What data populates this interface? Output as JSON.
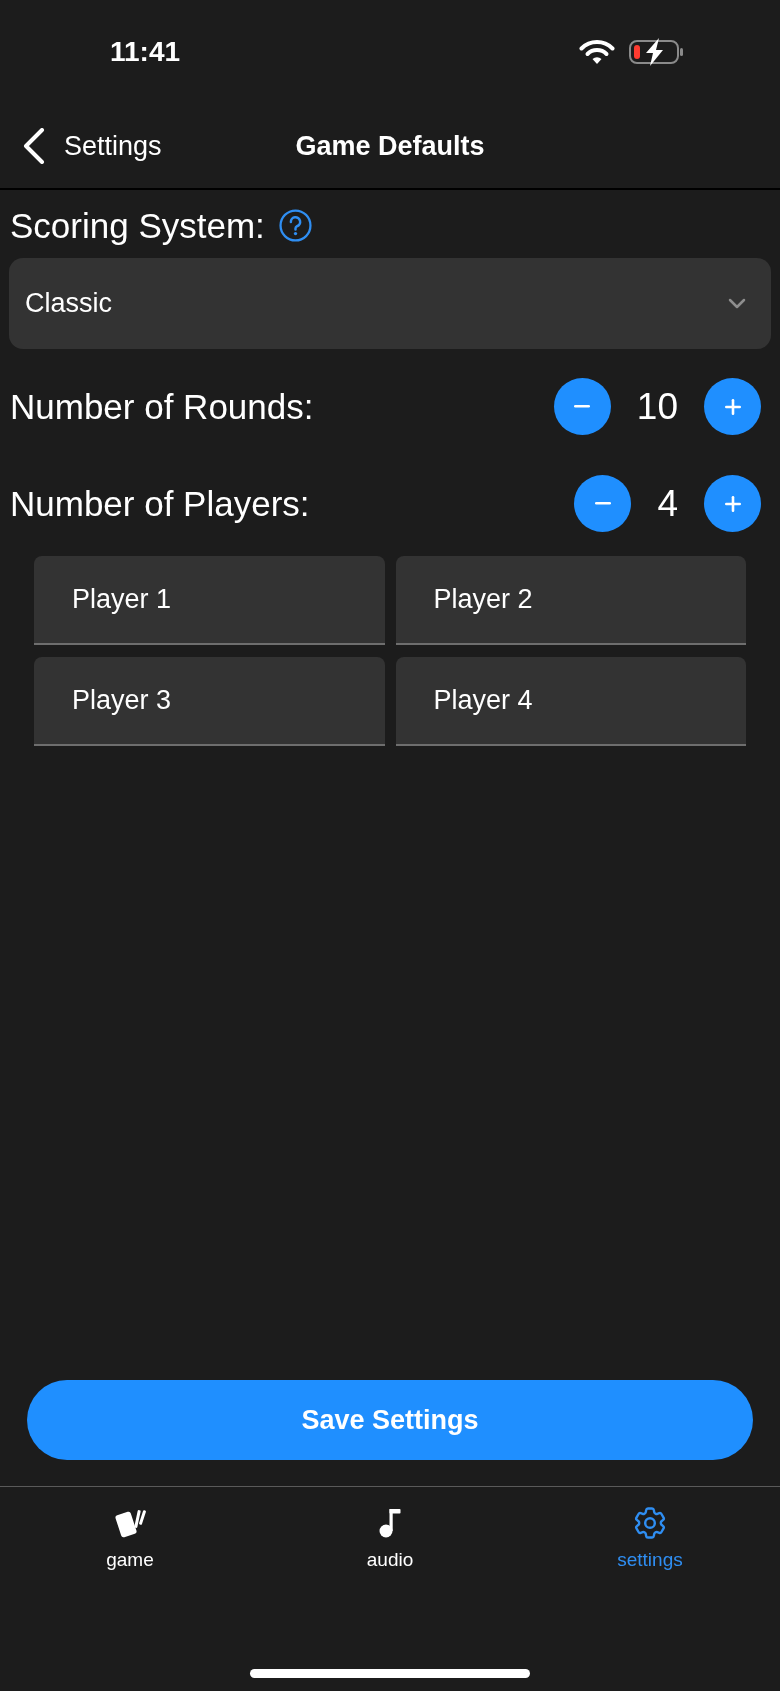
{
  "status_bar": {
    "time": "11:41"
  },
  "nav_bar": {
    "back_label": "Settings",
    "title": "Game Defaults"
  },
  "scoring_system": {
    "label": "Scoring System:",
    "value": "Classic"
  },
  "steppers": [
    {
      "label": "Number of Rounds:",
      "value": "10"
    },
    {
      "label": "Number of Players:",
      "value": "4"
    }
  ],
  "player_fields": [
    {
      "value": "Player 1"
    },
    {
      "value": "Player 2"
    },
    {
      "value": "Player 3"
    },
    {
      "value": "Player 4"
    }
  ],
  "save_button": {
    "label": "Save Settings"
  },
  "tab_bar": [
    {
      "label": "game",
      "selected": false
    },
    {
      "label": "audio",
      "selected": false
    },
    {
      "label": "settings",
      "selected": true
    }
  ]
}
